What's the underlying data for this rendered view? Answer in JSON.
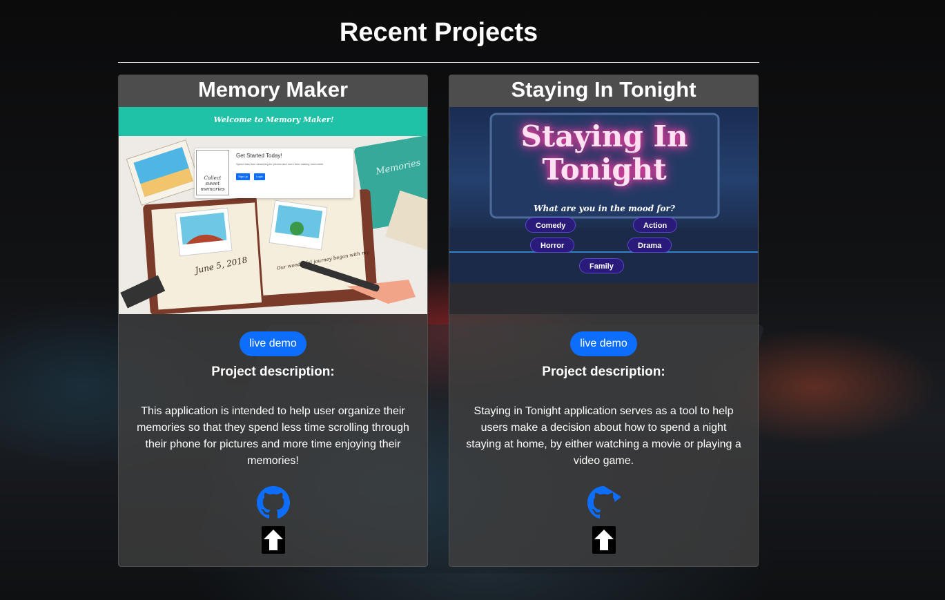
{
  "section": {
    "title": "Recent Projects"
  },
  "projects": [
    {
      "title": "Memory Maker",
      "demo_label": "live demo",
      "desc_title": "Project description:",
      "description": "This application is intended to help user organize their memories so that they spend less time scrolling through their phone for pictures and more time enjoying their memories!",
      "screenshot": {
        "banner": "Welcome to Memory Maker!",
        "modal_title": "Get Started Today!",
        "modal_text": "Spend less time searching for photos and more time making memories!",
        "btn_signup": "Sign up",
        "btn_login": "Login",
        "polaroid_text": "Collect sweet memories",
        "date": "June 5, 2018",
        "note": "Our wonderful journey began with my",
        "sticker": "Memories"
      }
    },
    {
      "title": "Staying In Tonight",
      "demo_label": "live demo",
      "desc_title": "Project description:",
      "description": "Staying in Tonight application serves as a tool to help users make a decision about how to spend a night staying at home, by either watching a movie or playing a video game.",
      "screenshot": {
        "title_line1": "Staying In",
        "title_line2": "Tonight",
        "subtitle": "What are you in the mood for?",
        "options": [
          "Comedy",
          "Action",
          "Horror",
          "Drama",
          "Family"
        ]
      }
    }
  ],
  "icons": {
    "repo": "github-icon",
    "top": "arrow-up-icon"
  },
  "colors": {
    "accent": "#0d6efd",
    "card": "#404040",
    "header": "#4d4d4d"
  }
}
